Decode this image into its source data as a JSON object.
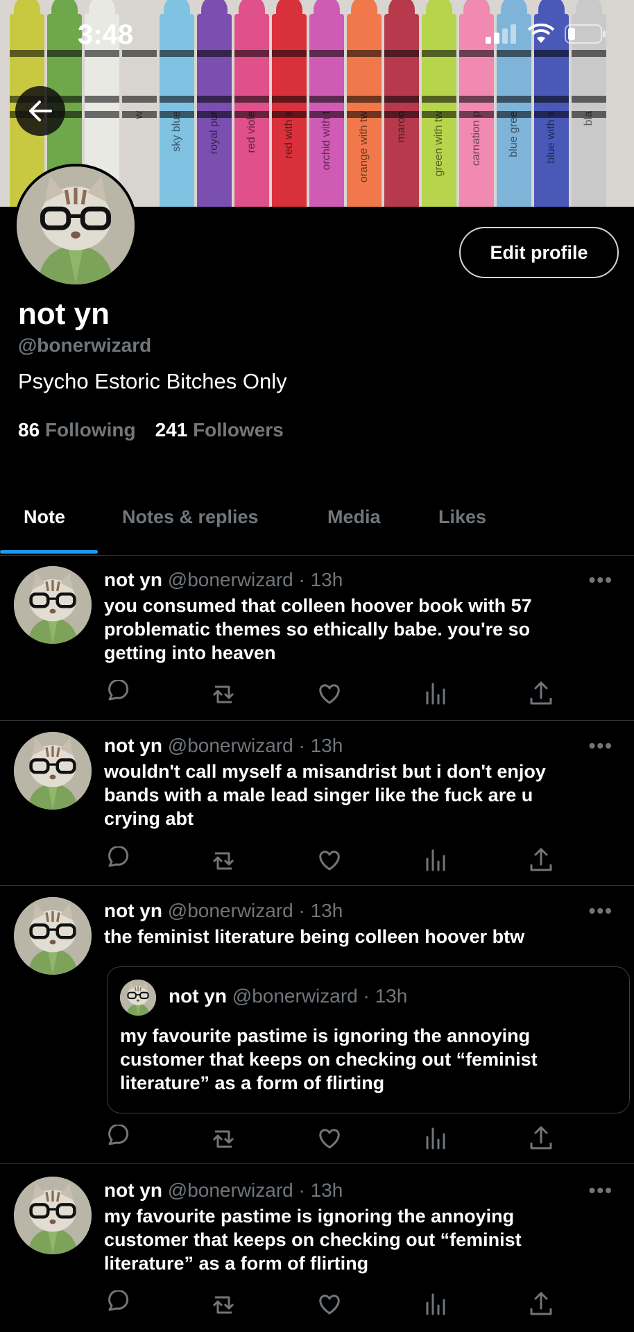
{
  "status_bar": {
    "time": "3:48"
  },
  "banner": {
    "crayons": [
      {
        "color": "#c8c940",
        "label": ""
      },
      {
        "color": "#6ea84a",
        "label": ""
      },
      {
        "color": "#e9e9e4",
        "label": ""
      },
      {
        "color": "#d8d4cf",
        "label": "w"
      },
      {
        "color": "#7fc2e2",
        "label": "sky blue"
      },
      {
        "color": "#7a4fb0",
        "label": "royal pur"
      },
      {
        "color": "#e0508a",
        "label": "red viole"
      },
      {
        "color": "#d9313c",
        "label": "red with s"
      },
      {
        "color": "#cf5bb4",
        "label": "orchid with t"
      },
      {
        "color": "#f0784a",
        "label": "orange with tw"
      },
      {
        "color": "#b73a4c",
        "label": "maroo"
      },
      {
        "color": "#b7d44d",
        "label": "green with tw"
      },
      {
        "color": "#f08ab0",
        "label": "carnation p"
      },
      {
        "color": "#7fb4d9",
        "label": "blue gree"
      },
      {
        "color": "#4a58b8",
        "label": "blue with s"
      },
      {
        "color": "#c9c9c9",
        "label": "bla"
      }
    ]
  },
  "header": {
    "back_label": "Back"
  },
  "profile": {
    "display_name": "not yn",
    "handle": "@bonerwizard",
    "bio": "Psycho Estoric Bitches Only",
    "following_count": "86",
    "following_label": "Following",
    "followers_count": "241",
    "followers_label": "Followers",
    "edit_label": "Edit profile"
  },
  "tabs": [
    {
      "label": "Note",
      "active": true
    },
    {
      "label": "Notes & replies",
      "active": false
    },
    {
      "label": "Media",
      "active": false
    },
    {
      "label": "Likes",
      "active": false
    }
  ],
  "tweets": [
    {
      "name": "not yn",
      "meta": "@bonerwizard · 13h",
      "text": "you consumed that colleen hoover book with 57 problematic themes so ethically babe. you're so getting into heaven"
    },
    {
      "name": "not yn",
      "meta": "@bonerwizard · 13h",
      "text": "wouldn't call myself a misandrist but i don't enjoy bands with a male lead singer like the fuck are u crying abt"
    },
    {
      "name": "not yn",
      "meta": "@bonerwizard · 13h",
      "text": "the feminist literature being colleen hoover btw",
      "quote": {
        "name": "not yn",
        "meta": "@bonerwizard · 13h",
        "text": "my favourite pastime is ignoring the annoying customer that keeps on checking out “feminist literature” as a form of flirting"
      }
    },
    {
      "name": "not yn",
      "meta": "@bonerwizard · 13h",
      "text": "my favourite pastime is ignoring the annoying customer that keeps on checking out “feminist literature” as a form of flirting"
    }
  ],
  "more_glyph": "•••",
  "action_icons": [
    "reply-icon",
    "retweet-icon",
    "like-icon",
    "views-icon",
    "share-icon"
  ]
}
